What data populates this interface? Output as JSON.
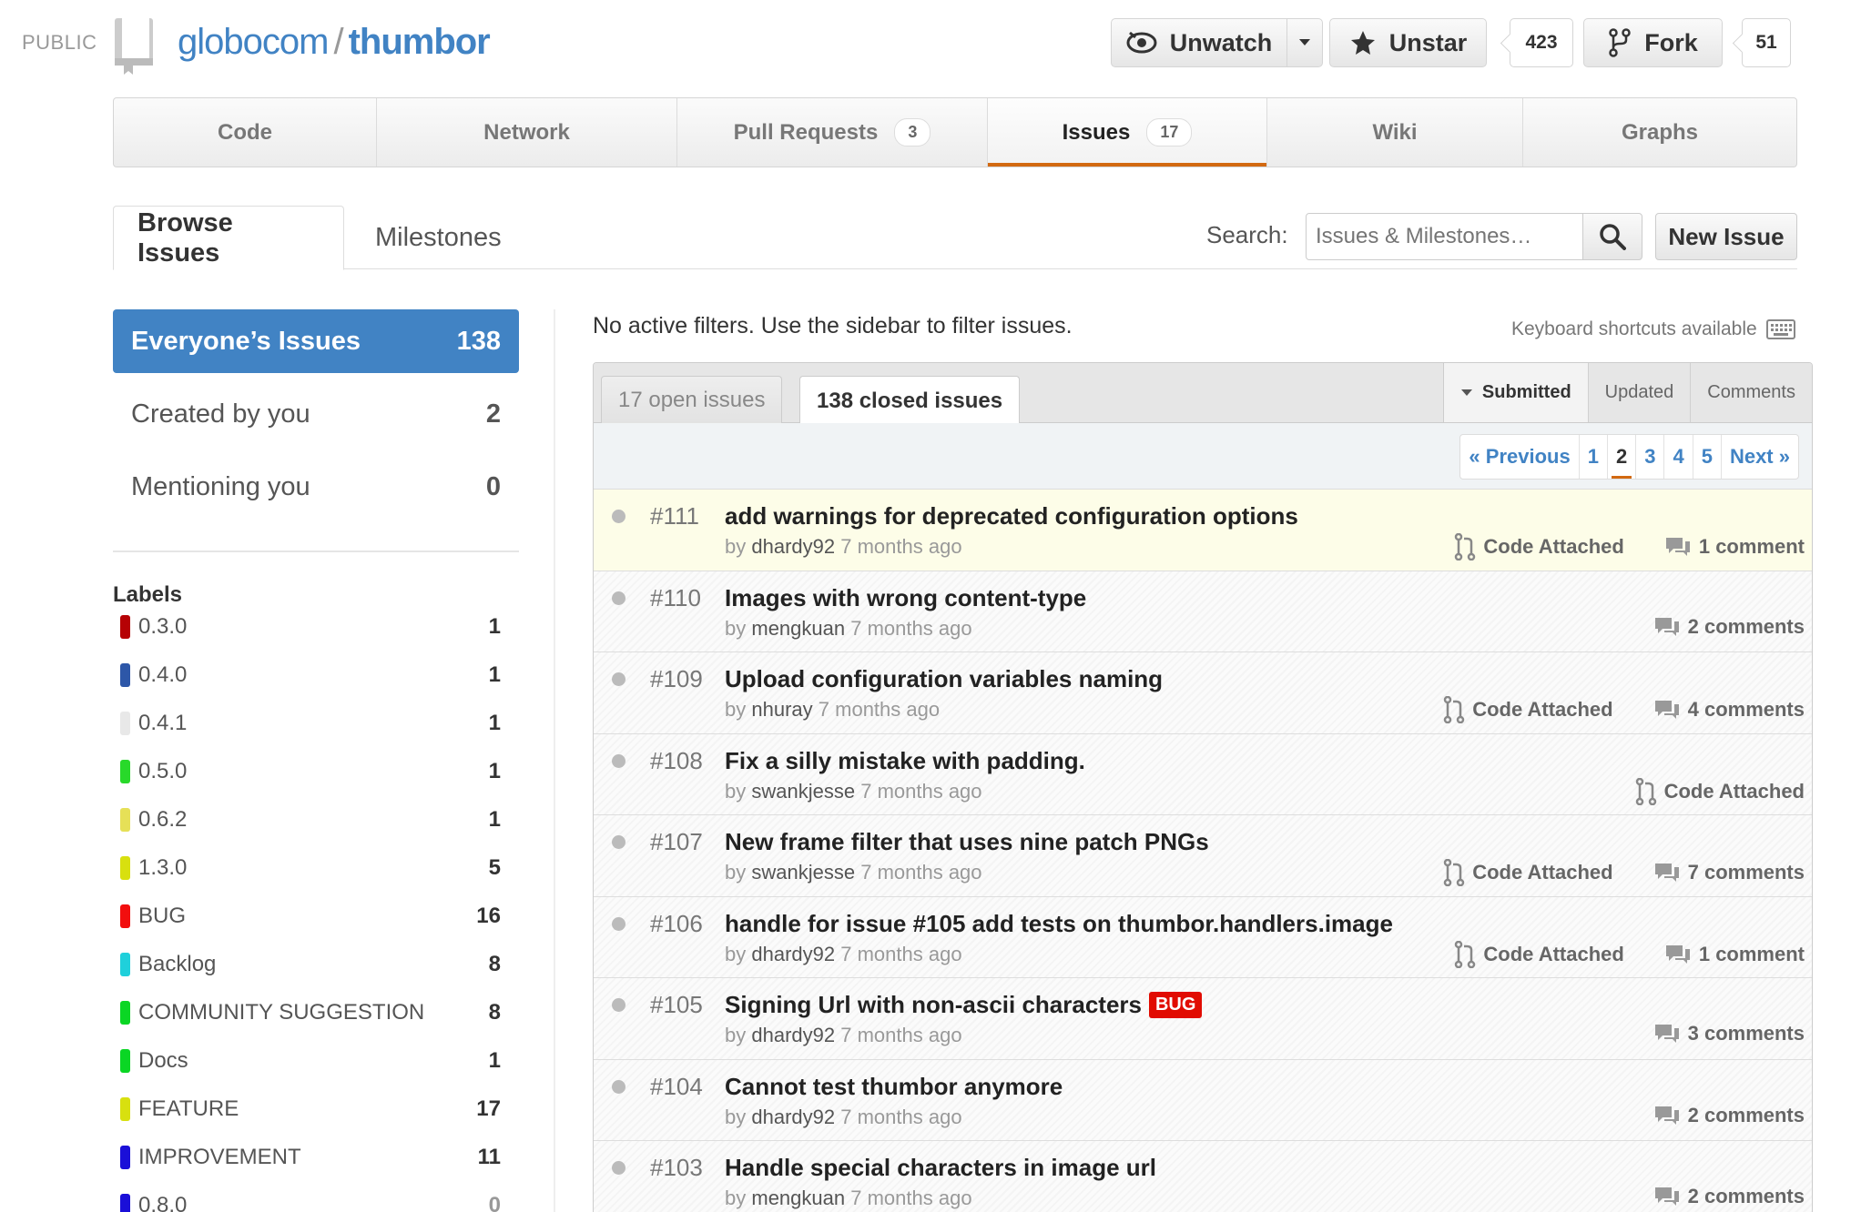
{
  "header": {
    "public_label": "PUBLIC",
    "owner": "globocom",
    "separator": "/",
    "repo": "thumbor",
    "unwatch_label": "Unwatch",
    "unstar_label": "Unstar",
    "star_count": "423",
    "fork_label": "Fork",
    "fork_count": "51"
  },
  "nav": {
    "code": "Code",
    "network": "Network",
    "pulls": "Pull Requests",
    "pulls_count": "3",
    "issues": "Issues",
    "issues_count": "17",
    "wiki": "Wiki",
    "graphs": "Graphs"
  },
  "subtabs": {
    "browse": "Browse Issues",
    "milestones": "Milestones"
  },
  "search": {
    "label": "Search:",
    "placeholder": "Issues & Milestones…",
    "new_issue": "New Issue"
  },
  "sidebar": {
    "filters": [
      {
        "label": "Everyone’s Issues",
        "count": "138"
      },
      {
        "label": "Created by you",
        "count": "2"
      },
      {
        "label": "Mentioning you",
        "count": "0"
      }
    ],
    "labels_heading": "Labels",
    "labels": [
      {
        "name": "0.3.0",
        "count": "1",
        "color": "#b60205"
      },
      {
        "name": "0.4.0",
        "count": "1",
        "color": "#2d57a8"
      },
      {
        "name": "0.4.1",
        "count": "1",
        "color": "#e8e8e8"
      },
      {
        "name": "0.5.0",
        "count": "1",
        "color": "#28d92a"
      },
      {
        "name": "0.6.2",
        "count": "1",
        "color": "#e6e057"
      },
      {
        "name": "1.3.0",
        "count": "5",
        "color": "#d8e00f"
      },
      {
        "name": "BUG",
        "count": "16",
        "color": "#f20e0e"
      },
      {
        "name": "Backlog",
        "count": "8",
        "color": "#1fd0db"
      },
      {
        "name": "COMMUNITY SUGGESTION",
        "count": "8",
        "color": "#0ad624"
      },
      {
        "name": "Docs",
        "count": "1",
        "color": "#0ad624"
      },
      {
        "name": "FEATURE",
        "count": "17",
        "color": "#d8e00f"
      },
      {
        "name": "IMPROVEMENT",
        "count": "11",
        "color": "#1a0fd8"
      },
      {
        "name": "0.8.0",
        "count": "0",
        "color": "#1a0fd8"
      }
    ]
  },
  "main": {
    "filter_note": "No active filters. Use the sidebar to filter issues.",
    "kbd_note": "Keyboard shortcuts available",
    "open_tab": "17 open issues",
    "closed_tab": "138 closed issues",
    "sorts": [
      "Submitted",
      "Updated",
      "Comments"
    ],
    "pager": [
      "« Previous",
      "1",
      "2",
      "3",
      "4",
      "5",
      "Next »"
    ],
    "current_page": "2"
  },
  "issues": [
    {
      "number": "#111",
      "title": "add warnings for deprecated configuration options",
      "by": "by",
      "author": "dhardy92",
      "time": "7 months ago",
      "code": "Code Attached",
      "comments": "1 comment",
      "badge": ""
    },
    {
      "number": "#110",
      "title": "Images with wrong content-type",
      "by": "by",
      "author": "mengkuan",
      "time": "7 months ago",
      "code": "",
      "comments": "2 comments",
      "badge": ""
    },
    {
      "number": "#109",
      "title": "Upload configuration variables naming",
      "by": "by",
      "author": "nhuray",
      "time": "7 months ago",
      "code": "Code Attached",
      "comments": "4 comments",
      "badge": ""
    },
    {
      "number": "#108",
      "title": "Fix a silly mistake with padding.",
      "by": "by",
      "author": "swankjesse",
      "time": "7 months ago",
      "code": "Code Attached",
      "comments": "",
      "badge": ""
    },
    {
      "number": "#107",
      "title": "New frame filter that uses nine patch PNGs",
      "by": "by",
      "author": "swankjesse",
      "time": "7 months ago",
      "code": "Code Attached",
      "comments": "7 comments",
      "badge": ""
    },
    {
      "number": "#106",
      "title": "handle for issue #105 add tests on thumbor.handlers.image",
      "by": "by",
      "author": "dhardy92",
      "time": "7 months ago",
      "code": "Code Attached",
      "comments": "1 comment",
      "badge": ""
    },
    {
      "number": "#105",
      "title": "Signing Url with non-ascii characters",
      "by": "by",
      "author": "dhardy92",
      "time": "7 months ago",
      "code": "",
      "comments": "3 comments",
      "badge": "BUG"
    },
    {
      "number": "#104",
      "title": "Cannot test thumbor anymore",
      "by": "by",
      "author": "dhardy92",
      "time": "7 months ago",
      "code": "",
      "comments": "2 comments",
      "badge": ""
    },
    {
      "number": "#103",
      "title": "Handle special characters in image url",
      "by": "by",
      "author": "mengkuan",
      "time": "7 months ago",
      "code": "",
      "comments": "2 comments",
      "badge": ""
    }
  ]
}
